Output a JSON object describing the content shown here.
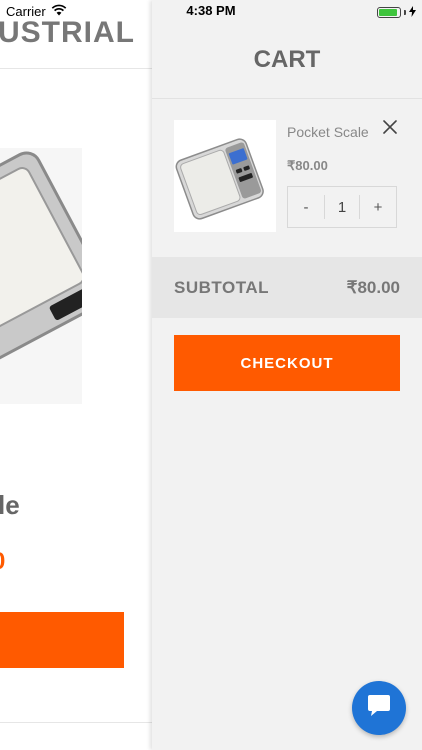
{
  "status_bar": {
    "carrier": "Carrier",
    "time": "4:38 PM"
  },
  "background_page": {
    "brand_partial": "USTRIAL",
    "product_title_partial": "le",
    "price_partial": "0"
  },
  "cart": {
    "title": "CART",
    "items": [
      {
        "name": "Pocket Scale",
        "price": "₹80.00",
        "quantity": "1",
        "decrement_label": "-",
        "increment_label": "+"
      }
    ],
    "subtotal_label": "SUBTOTAL",
    "subtotal_value": "₹80.00",
    "checkout_label": "CHECKOUT"
  },
  "colors": {
    "accent": "#ff5a00",
    "chat_button": "#1f74d6",
    "panel_bg": "#f2f2f2"
  },
  "icons": [
    "wifi-icon",
    "battery-icon",
    "charging-icon",
    "close-icon",
    "chat-icon"
  ]
}
